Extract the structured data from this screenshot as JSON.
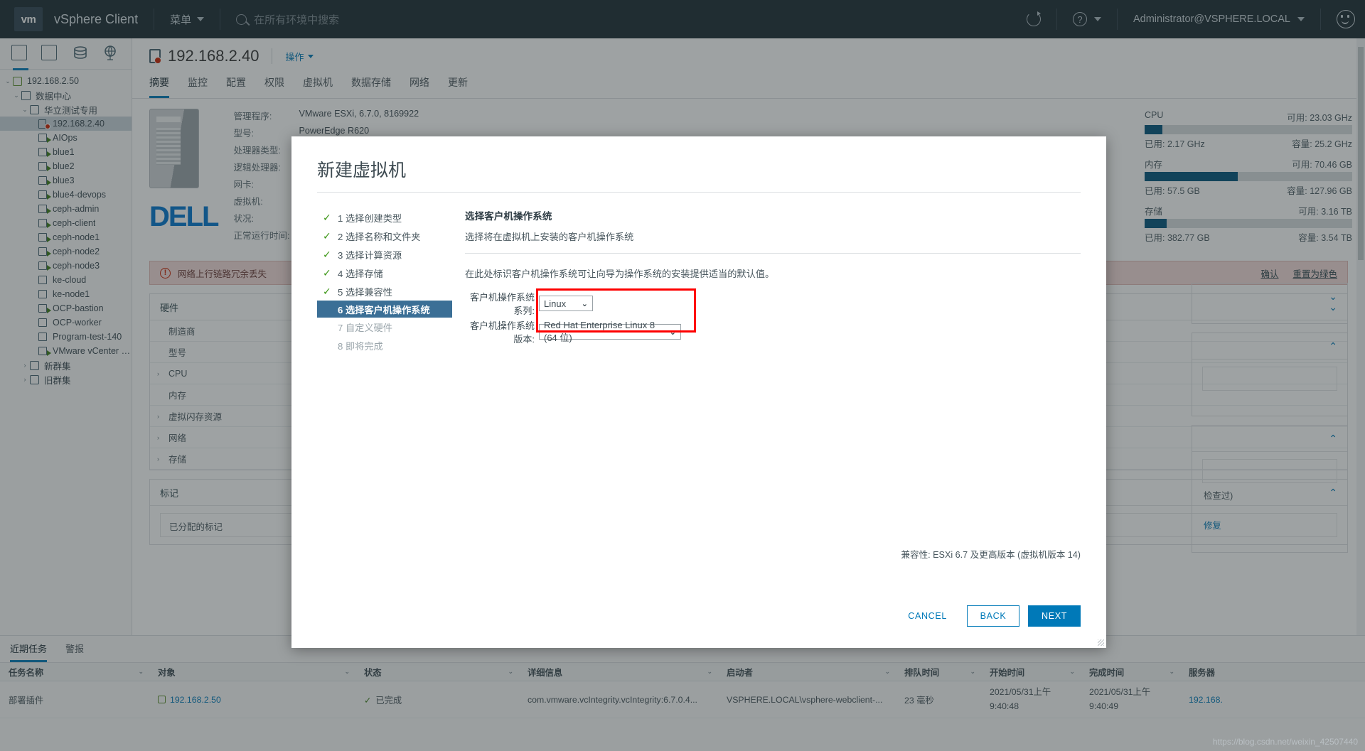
{
  "topbar": {
    "logo": "vm",
    "app_title": "vSphere Client",
    "menu_label": "菜单",
    "search_placeholder": "在所有环境中搜索",
    "user": "Administrator@VSPHERE.LOCAL",
    "icons": {
      "refresh": "refresh-icon",
      "help": "?",
      "smiley": "smiley-icon"
    }
  },
  "sidebar": {
    "tabs": [
      "hosts-clusters-icon",
      "vms-templates-icon",
      "datastores-icon",
      "networks-icon"
    ],
    "tree": [
      {
        "label": "192.168.2.50",
        "depth": 0,
        "twist": "v",
        "icon": "vcenter",
        "state": ""
      },
      {
        "label": "数据中心",
        "depth": 1,
        "twist": "v",
        "icon": "dc",
        "state": ""
      },
      {
        "label": "华立测试专用",
        "depth": 2,
        "twist": "v",
        "icon": "folder",
        "state": ""
      },
      {
        "label": "192.168.2.40",
        "depth": 3,
        "twist": "",
        "icon": "host",
        "state": "error"
      },
      {
        "label": "AIOps",
        "depth": 3,
        "twist": "",
        "icon": "vm",
        "state": "running"
      },
      {
        "label": "blue1",
        "depth": 3,
        "twist": "",
        "icon": "vm",
        "state": "running"
      },
      {
        "label": "blue2",
        "depth": 3,
        "twist": "",
        "icon": "vm",
        "state": "running"
      },
      {
        "label": "blue3",
        "depth": 3,
        "twist": "",
        "icon": "vm",
        "state": "running"
      },
      {
        "label": "blue4-devops",
        "depth": 3,
        "twist": "",
        "icon": "vm",
        "state": "running"
      },
      {
        "label": "ceph-admin",
        "depth": 3,
        "twist": "",
        "icon": "vm",
        "state": "running"
      },
      {
        "label": "ceph-client",
        "depth": 3,
        "twist": "",
        "icon": "vm",
        "state": "running"
      },
      {
        "label": "ceph-node1",
        "depth": 3,
        "twist": "",
        "icon": "vm",
        "state": "running"
      },
      {
        "label": "ceph-node2",
        "depth": 3,
        "twist": "",
        "icon": "vm",
        "state": "running"
      },
      {
        "label": "ceph-node3",
        "depth": 3,
        "twist": "",
        "icon": "vm",
        "state": "running"
      },
      {
        "label": "ke-cloud",
        "depth": 3,
        "twist": "",
        "icon": "vm",
        "state": ""
      },
      {
        "label": "ke-node1",
        "depth": 3,
        "twist": "",
        "icon": "vm",
        "state": ""
      },
      {
        "label": "OCP-bastion",
        "depth": 3,
        "twist": "",
        "icon": "vm",
        "state": "running"
      },
      {
        "label": "OCP-worker",
        "depth": 3,
        "twist": "",
        "icon": "vm",
        "state": ""
      },
      {
        "label": "Program-test-140",
        "depth": 3,
        "twist": "",
        "icon": "vm",
        "state": ""
      },
      {
        "label": "VMware vCenter S...",
        "depth": 3,
        "twist": "",
        "icon": "vm",
        "state": "running"
      },
      {
        "label": "新群集",
        "depth": 2,
        "twist": ">",
        "icon": "folder",
        "state": ""
      },
      {
        "label": "旧群集",
        "depth": 2,
        "twist": ">",
        "icon": "folder",
        "state": ""
      }
    ],
    "selected_index": 3
  },
  "page": {
    "title": "192.168.2.40",
    "actions_label": "操作",
    "tabs": [
      "摘要",
      "监控",
      "配置",
      "权限",
      "虚拟机",
      "数据存储",
      "网络",
      "更新"
    ],
    "active_tab": "摘要"
  },
  "host_summary": {
    "fields": [
      {
        "key": "管理程序:",
        "value": "VMware ESXi, 6.7.0, 8169922"
      },
      {
        "key": "型号:",
        "value": "PowerEdge R620"
      },
      {
        "key": "处理器类型:",
        "value": ""
      },
      {
        "key": "逻辑处理器:",
        "value": ""
      },
      {
        "key": "网卡:",
        "value": ""
      },
      {
        "key": "虚拟机:",
        "value": ""
      },
      {
        "key": "状况:",
        "value": ""
      },
      {
        "key": "正常运行时间:",
        "value": ""
      }
    ],
    "vendor_logo": "DELL",
    "meters": [
      {
        "name": "CPU",
        "free_label": "可用: 23.03 GHz",
        "used_label": "已用: 2.17 GHz",
        "capacity_label": "容量: 25.2 GHz",
        "percent": 8.6
      },
      {
        "name": "内存",
        "free_label": "可用: 70.46 GB",
        "used_label": "已用: 57.5 GB",
        "capacity_label": "容量: 127.96 GB",
        "percent": 44.9
      },
      {
        "name": "存储",
        "free_label": "可用: 3.16 TB",
        "used_label": "已用: 382.77 GB",
        "capacity_label": "容量: 3.54 TB",
        "percent": 10.6
      }
    ]
  },
  "alert": {
    "text": "网络上行链路冗余丢失",
    "icon": "!",
    "links": [
      "确认",
      "重置为绿色"
    ]
  },
  "hardware_panel": {
    "title": "硬件",
    "rows": [
      {
        "label": "制造商",
        "expandable": false
      },
      {
        "label": "型号",
        "expandable": false
      },
      {
        "label": "CPU",
        "expandable": true
      },
      {
        "label": "内存",
        "expandable": false
      },
      {
        "label": "虚拟闪存资源",
        "expandable": true
      },
      {
        "label": "网络",
        "expandable": true
      },
      {
        "label": "存储",
        "expandable": true
      }
    ]
  },
  "tags_panel": {
    "title": "标记",
    "row_label": "已分配的标记"
  },
  "side_panels": [
    {
      "title": "",
      "chevron": "v"
    },
    {
      "title": "",
      "chevron": "^",
      "note": ""
    },
    {
      "title": "",
      "chevron": "^",
      "note": "检查过)",
      "link": "修复"
    }
  ],
  "dialog": {
    "title": "新建虚拟机",
    "steps": [
      {
        "num": "1",
        "label": "选择创建类型",
        "state": "done"
      },
      {
        "num": "2",
        "label": "选择名称和文件夹",
        "state": "done"
      },
      {
        "num": "3",
        "label": "选择计算资源",
        "state": "done"
      },
      {
        "num": "4",
        "label": "选择存储",
        "state": "done"
      },
      {
        "num": "5",
        "label": "选择兼容性",
        "state": "done"
      },
      {
        "num": "6",
        "label": "选择客户机操作系统",
        "state": "current"
      },
      {
        "num": "7",
        "label": "自定义硬件",
        "state": "todo"
      },
      {
        "num": "8",
        "label": "即将完成",
        "state": "todo"
      }
    ],
    "heading": "选择客户机操作系统",
    "subheading": "选择将在虚拟机上安装的客户机操作系统",
    "note": "在此处标识客户机操作系统可让向导为操作系统的安装提供适当的默认值。",
    "fields": [
      {
        "label": "客户机操作系统系列:",
        "value": "Linux",
        "name": "guest-os-family-select"
      },
      {
        "label": "客户机操作系统版本:",
        "value": "Red Hat Enterprise Linux 8 (64 位)",
        "name": "guest-os-version-select"
      }
    ],
    "compatibility": "兼容性: ESXi 6.7 及更高版本 (虚拟机版本 14)",
    "buttons": {
      "cancel": "CANCEL",
      "back": "BACK",
      "next": "NEXT"
    },
    "highlight_color": "#fe0000"
  },
  "tasks": {
    "tabs": [
      "近期任务",
      "警报"
    ],
    "active_tab": "近期任务",
    "columns": [
      "任务名称",
      "对象",
      "状态",
      "详细信息",
      "启动者",
      "排队时间",
      "开始时间",
      "完成时间",
      "服务器"
    ],
    "rows": [
      {
        "task": "部署插件",
        "object": "192.168.2.50",
        "status": "已完成",
        "details": "com.vmware.vcIntegrity.vcIntegrity:6.7.0.4...",
        "initiator": "VSPHERE.LOCAL\\vsphere-webclient-...",
        "queue_time": "23 毫秒",
        "start_time": "2021/05/31上午 9:40:48",
        "complete_time": "2021/05/31上午 9:40:49",
        "server": "192.168."
      }
    ]
  },
  "watermark": "https://blog.csdn.net/weixin_42507440"
}
